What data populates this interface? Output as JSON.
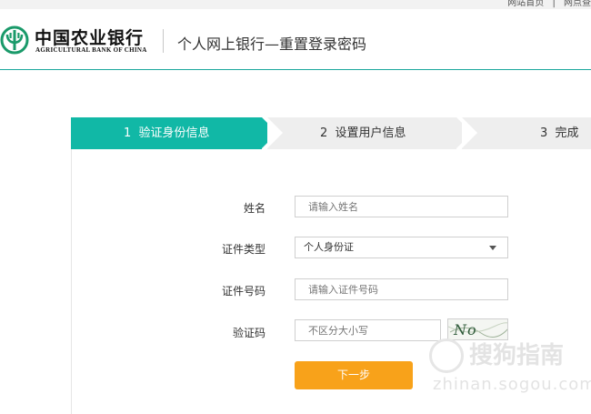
{
  "top_links": [
    "网站首页",
    "网点查"
  ],
  "header": {
    "bank_name_cn": "中国农业银行",
    "bank_name_en": "AGRICULTURAL BANK OF CHINA",
    "page_title": "个人网上银行—重置登录密码"
  },
  "steps": [
    {
      "number": "1",
      "label": "验证身份信息",
      "active": true
    },
    {
      "number": "2",
      "label": "设置用户信息",
      "active": false
    },
    {
      "number": "3",
      "label": "完成",
      "active": false
    }
  ],
  "form": {
    "name": {
      "label": "姓名",
      "placeholder": "请输入姓名"
    },
    "id_type": {
      "label": "证件类型",
      "selected": "个人身份证"
    },
    "id_number": {
      "label": "证件号码",
      "placeholder": "请输入证件号码"
    },
    "captcha": {
      "label": "验证码",
      "placeholder": "不区分大小写",
      "image_text": "No QD"
    },
    "next_label": "下一步"
  },
  "watermark": {
    "cn": "搜狗指南",
    "en": "zhinan.sogou.com"
  },
  "colors": {
    "accent": "#11b8a6",
    "button": "#f8a21a",
    "step_inactive": "#eeeeee"
  }
}
